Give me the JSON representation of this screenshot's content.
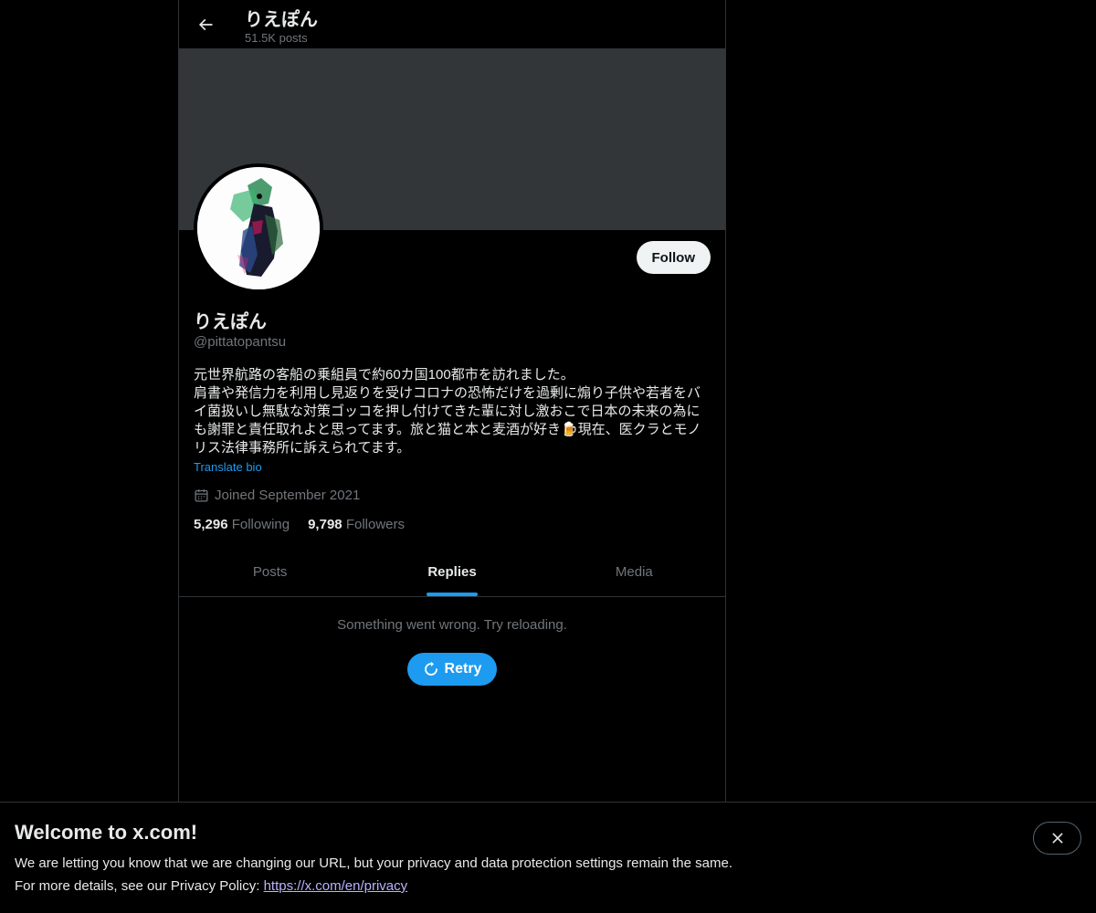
{
  "header": {
    "title": "りえぽん",
    "posts_count": "51.5K posts"
  },
  "profile": {
    "follow_label": "Follow",
    "name": "りえぽん",
    "handle": "@pittatopantsu",
    "bio": "元世界航路の客船の乗組員で約60カ国100都市を訪れました。\n肩書や発信力を利用し見返りを受けコロナの恐怖だけを過剰に煽り子供や若者をバイ菌扱いし無駄な対策ゴッコを押し付けてきた輩に対し激おこで日本の未来の為にも謝罪と責任取れよと思ってます。旅と猫と本と麦酒が好き🍺現在、医クラとモノリス法律事務所に訴えられてます。",
    "translate_label": "Translate bio",
    "joined": "Joined September 2021",
    "following_count": "5,296",
    "following_label": "Following",
    "followers_count": "9,798",
    "followers_label": "Followers"
  },
  "tabs": [
    {
      "label": "Posts",
      "active": false
    },
    {
      "label": "Replies",
      "active": true
    },
    {
      "label": "Media",
      "active": false
    }
  ],
  "feed": {
    "error_message": "Something went wrong. Try reloading.",
    "retry_label": "Retry"
  },
  "cookie_banner": {
    "title": "Welcome to x.com!",
    "line1": "We are letting you know that we are changing our URL, but your privacy and data protection settings remain the same.",
    "line2_prefix": "For more details, see our Privacy Policy: ",
    "link_text": "https://x.com/en/privacy"
  },
  "colors": {
    "accent": "#1d9bf0",
    "background": "#000000",
    "banner": "#333639",
    "muted_text": "#71767b"
  }
}
